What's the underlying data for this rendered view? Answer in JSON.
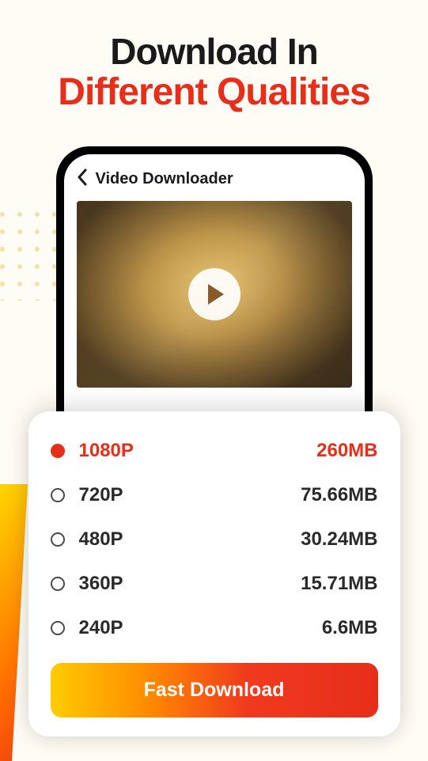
{
  "heading": {
    "line1": "Download In",
    "line2": "Different Qualities"
  },
  "screen": {
    "title": "Video Downloader",
    "back_icon": "chevron-left-icon",
    "play_icon": "play-icon"
  },
  "qualities": [
    {
      "label": "1080P",
      "size": "260MB",
      "selected": true
    },
    {
      "label": "720P",
      "size": "75.66MB",
      "selected": false
    },
    {
      "label": "480P",
      "size": "30.24MB",
      "selected": false
    },
    {
      "label": "360P",
      "size": "15.71MB",
      "selected": false
    },
    {
      "label": "240P",
      "size": "6.6MB",
      "selected": false
    }
  ],
  "download_button": "Fast Download",
  "colors": {
    "accent": "#E62E1A",
    "gradient_start": "#FFCC00",
    "gradient_end": "#E62E1A"
  }
}
